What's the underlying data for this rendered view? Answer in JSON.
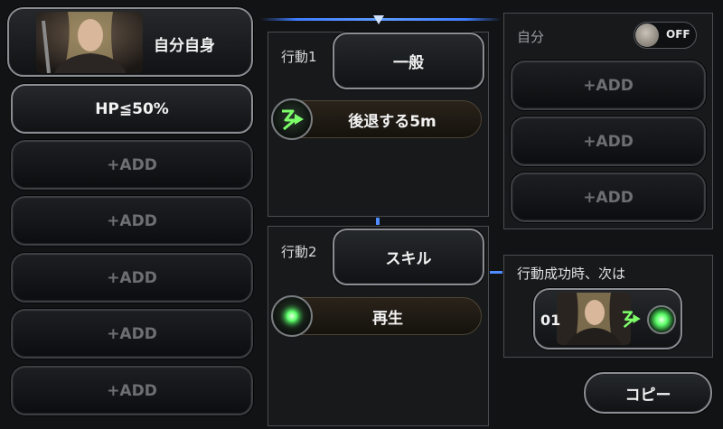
{
  "left": {
    "target_button": "自分自身",
    "condition_1": "HP≦50%",
    "add_label": "+ADD"
  },
  "middle": {
    "action1": {
      "label": "行動1",
      "type_button": "一般",
      "skill_name": "後退する5m",
      "skill_icon": "retreat-arrow-icon"
    },
    "action2": {
      "label": "行動2",
      "type_button": "スキル",
      "skill_name": "再生",
      "skill_icon": "green-orb-icon"
    }
  },
  "right": {
    "self_label": "自分",
    "toggle_label": "OFF",
    "add_label": "+ADD",
    "next_header": "行動成功時、次は",
    "next_number": "01",
    "copy_button": "コピー"
  },
  "colors": {
    "accent_blue": "#3f7dff",
    "green_glow": "#5dff6a"
  }
}
